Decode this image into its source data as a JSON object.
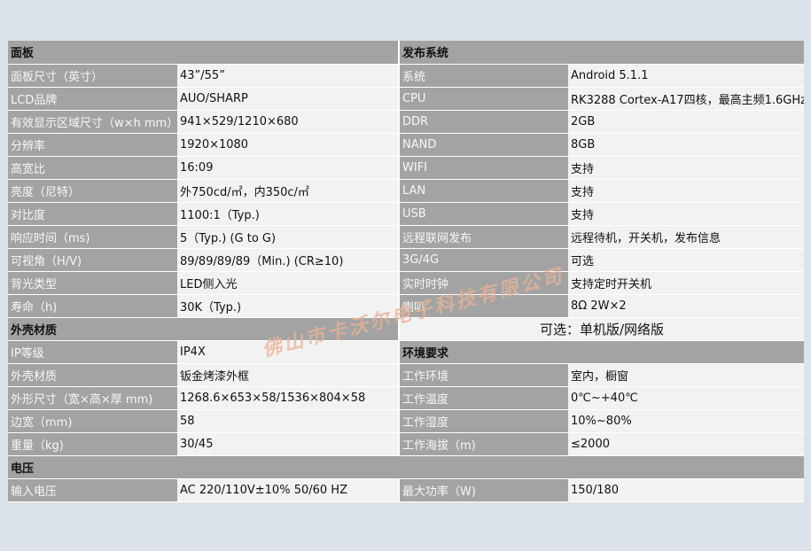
{
  "sections": {
    "panel": "面板",
    "publish": "发布系统",
    "shell": "外壳材质",
    "env": "环境要求",
    "power": "电压"
  },
  "panel_rows": [
    {
      "label": "面板尺寸（英寸）",
      "value": "43”/55”"
    },
    {
      "label": "LCD品牌",
      "value": "AUO/SHARP"
    },
    {
      "label": "有效显示区域尺寸（w×h mm）",
      "value": "941×529/1210×680"
    },
    {
      "label": "分辨率",
      "value": "1920×1080"
    },
    {
      "label": "高宽比",
      "value": "16:09"
    },
    {
      "label": "亮度（尼特）",
      "value": "外750cd/㎡，内350c/㎡"
    },
    {
      "label": "对比度",
      "value": "1100:1（Typ.)"
    },
    {
      "label": "响应时间（ms)",
      "value": "5（Typ.)   (G to G)"
    },
    {
      "label": "可视角（H/V)",
      "value": "89/89/89/89（Min.)    (CR≥10)"
    },
    {
      "label": "背光类型",
      "value": "LED侧入光"
    },
    {
      "label": "寿命（h)",
      "value": "30K（Typ.)"
    }
  ],
  "publish_rows": [
    {
      "label": "系统",
      "value": "Android 5.1.1"
    },
    {
      "label": "CPU",
      "value": "RK3288 Cortex-A17四核，最高主频1.6GHz"
    },
    {
      "label": "DDR",
      "value": "2GB"
    },
    {
      "label": "NAND",
      "value": "8GB"
    },
    {
      "label": "WIFI",
      "value": "支持"
    },
    {
      "label": "LAN",
      "value": "支持"
    },
    {
      "label": "USB",
      "value": "支持"
    },
    {
      "label": "远程联网发布",
      "value": "远程待机，开关机，发布信息"
    },
    {
      "label": "3G/4G",
      "value": "可选"
    },
    {
      "label": "实时时钟",
      "value": "支持定时开关机"
    },
    {
      "label": "喇叭",
      "value": "8Ω 2W×2"
    }
  ],
  "optional_note": "可选：单机版/网络版",
  "shell_rows": [
    {
      "label": "IP等级",
      "value": "IP4X"
    },
    {
      "label": "外壳材质",
      "value": "钣金烤漆外框"
    },
    {
      "label": "外形尺寸（宽×高×厚 mm)",
      "value": "1268.6×653×58/1536×804×58"
    },
    {
      "label": "边宽（mm)",
      "value": "58"
    },
    {
      "label": "重量（kg)",
      "value": "30/45"
    }
  ],
  "env_rows": [
    {
      "label": "工作环境",
      "value": "室内，橱窗"
    },
    {
      "label": "工作温度",
      "value": "0℃~+40℃"
    },
    {
      "label": "工作湿度",
      "value": "10%~80%"
    },
    {
      "label": "工作海拔（m)",
      "value": "≤2000"
    }
  ],
  "power_row": {
    "input_label": "输入电压",
    "input_value": "AC 220/110V±10%  50/60 HZ",
    "max_label": "最大功率（W)",
    "max_value": "150/180"
  },
  "watermark": "佛山市卡沃尔电子科技有限公司",
  "colors": {
    "header_bg": "#a3a3a3",
    "value_bg": "#f2f2f2",
    "page_bg": "#dbe2e9",
    "watermark": "#e8b39a"
  }
}
